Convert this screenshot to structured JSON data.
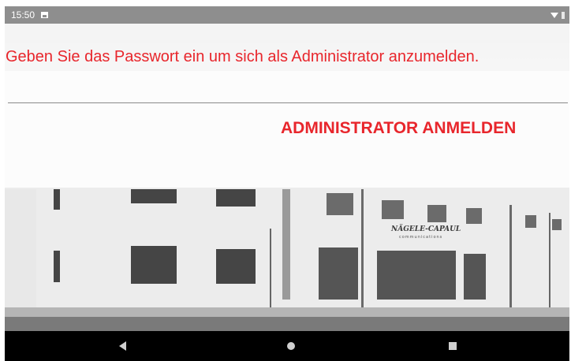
{
  "status_bar": {
    "time": "15:50",
    "left_icons": [
      "image-icon"
    ],
    "right_icons": [
      "wifi-icon",
      "battery-icon"
    ]
  },
  "background": {
    "sign_text": "NÄGELE-CAPAUL",
    "sign_subtext": "communications"
  },
  "login": {
    "prompt": "Geben Sie das Passwort ein um sich als Administrator anzumelden.",
    "password_value": "",
    "button_label": "ADMINISTRATOR ANMELDEN"
  },
  "navigation": {
    "buttons": [
      "back-icon",
      "home-icon",
      "recent-apps-icon"
    ]
  },
  "colors": {
    "accent": "#e8262c",
    "status_bar": "#8e8e8e",
    "nav_bar": "#000000"
  }
}
